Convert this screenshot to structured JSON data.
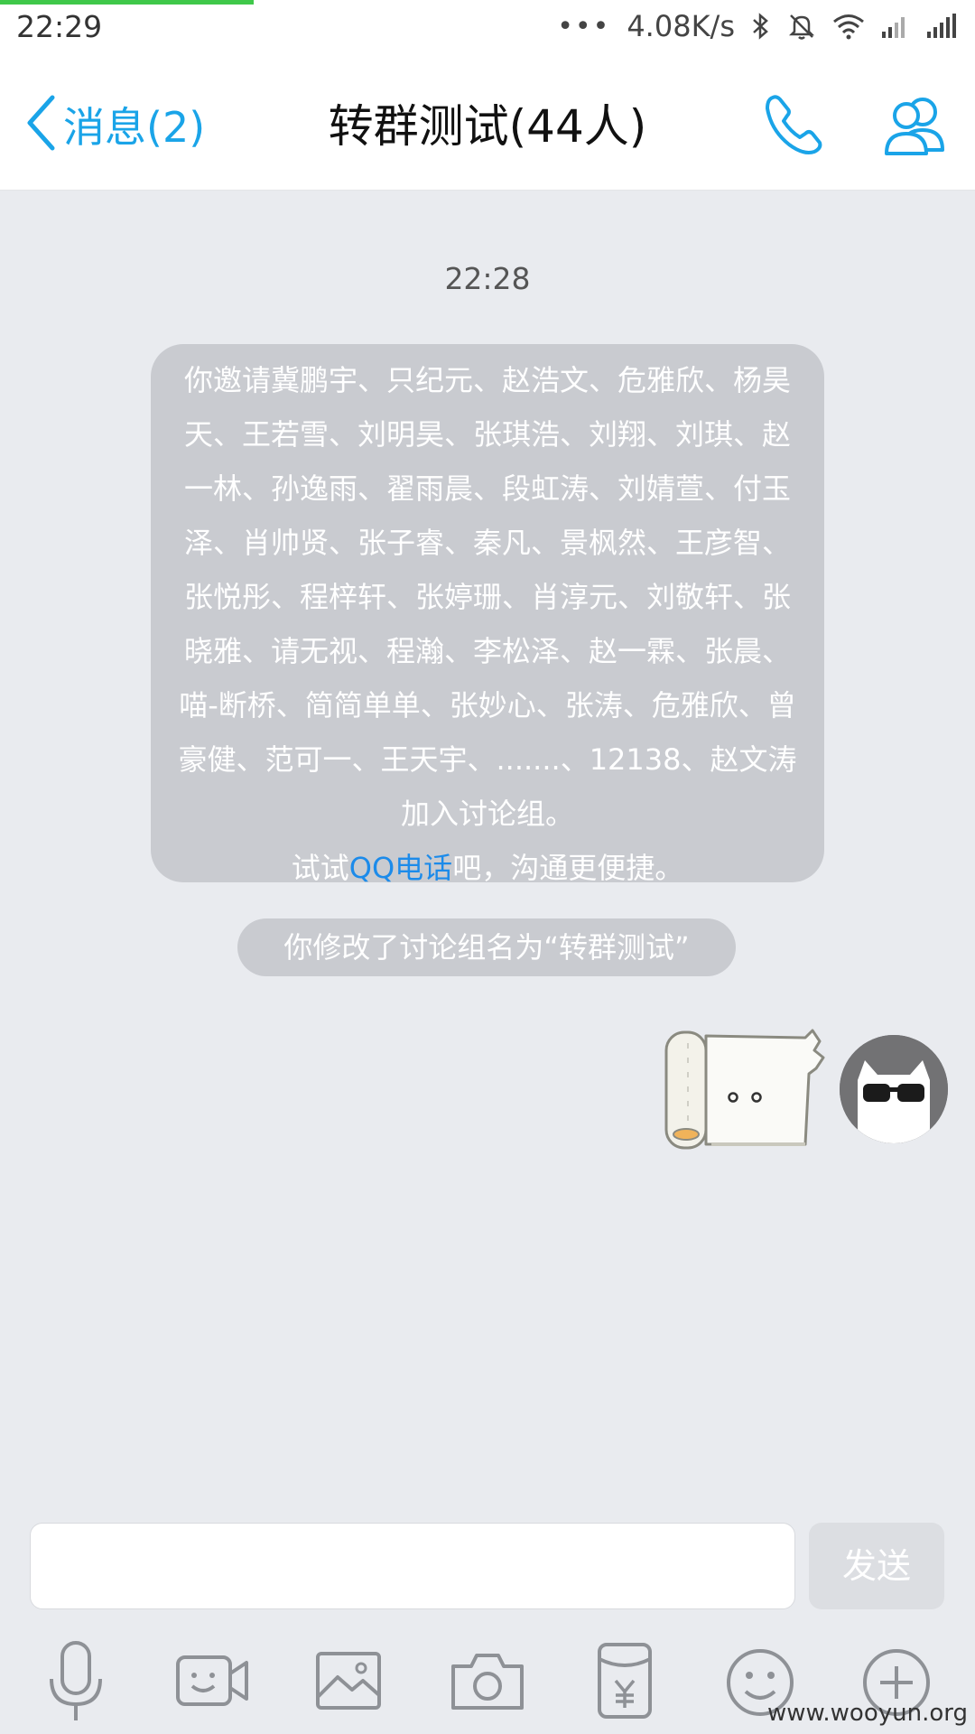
{
  "status_bar": {
    "time": "22:29",
    "dots": "•••",
    "net_speed": "4.08K/s",
    "progress_percent": 26
  },
  "nav": {
    "back_label": "消息(2)",
    "title": "转群测试(44人)",
    "icons": [
      "chevron-left-icon",
      "phone-icon",
      "group-members-icon"
    ]
  },
  "chat": {
    "timestamp": "22:28",
    "system_message": {
      "invite_text": "你邀请冀鹏宇、只纪元、赵浩文、危雅欣、杨昊天、王若雪、刘明昊、张琪浩、刘翔、刘琪、赵一林、孙逸雨、翟雨晨、段虹涛、刘婧萱、付玉泽、肖帅贤、张子睿、秦凡、景枫然、王彦智、张悦彤、程梓轩、张婷珊、肖淳元、刘敬轩、张晓雅、请无视、程瀚、李松泽、赵一霖、张晨、喵-断桥、简简单单、张妙心、张涛、危雅欣、曾豪健、范可一、王天宇、.......、12138、赵文涛加入讨论组。",
      "tip_prefix": "试试",
      "tip_link": "QQ电话",
      "tip_suffix": "吧，沟通更便捷。"
    },
    "rename_message": "你修改了讨论组名为“转群测试”"
  },
  "input": {
    "value": "",
    "placeholder": "",
    "send_label": "发送"
  },
  "toolbar_icons": [
    "microphone-icon",
    "video-icon",
    "image-icon",
    "camera-icon",
    "red-packet-icon",
    "emoji-icon",
    "plus-icon"
  ],
  "watermark": "www.wooyun.org",
  "colors": {
    "accent": "#1aa4e8",
    "link": "#1c8bea",
    "background": "#e9ebef",
    "system_bubble": "#c9cbd0",
    "progress": "#3fc84a"
  }
}
